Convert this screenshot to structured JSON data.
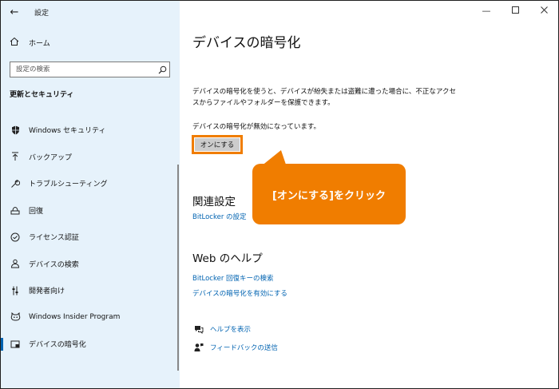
{
  "window": {
    "title": "設定"
  },
  "sidebar": {
    "home_label": "ホーム",
    "search_placeholder": "設定の検索",
    "section_title": "更新とセキュリティ",
    "items": [
      {
        "label": "Windows セキュリティ",
        "icon": "shield-icon"
      },
      {
        "label": "バックアップ",
        "icon": "backup-arrow-icon"
      },
      {
        "label": "トラブルシューティング",
        "icon": "wrench-icon"
      },
      {
        "label": "回復",
        "icon": "recovery-icon"
      },
      {
        "label": "ライセンス認証",
        "icon": "checkmark-circle-icon"
      },
      {
        "label": "デバイスの検索",
        "icon": "person-location-icon"
      },
      {
        "label": "開発者向け",
        "icon": "developer-sliders-icon"
      },
      {
        "label": "Windows Insider Program",
        "icon": "insider-cat-icon"
      },
      {
        "label": "デバイスの暗号化",
        "icon": "encryption-icon",
        "selected": true
      }
    ]
  },
  "main": {
    "title": "デバイスの暗号化",
    "description": "デバイスの暗号化を使うと、デバイスが紛失または盗難に遭った場合に、不正なアクセスからファイルやフォルダーを保護できます。",
    "status": "デバイスの暗号化が無効になっています。",
    "on_button": "オンにする",
    "related_title": "関連設定",
    "related_link": "BitLocker の設定",
    "help_title": "Web のヘルプ",
    "help_links": [
      "BitLocker 回復キーの検索",
      "デバイスの暗号化を有効にする"
    ],
    "get_help": "ヘルプを表示",
    "feedback": "フィードバックの送信"
  },
  "callout": {
    "text": "[オンにする]をクリック",
    "color": "#f07d00"
  },
  "colors": {
    "accent": "#0063b1",
    "sidebar_bg": "#e6f2fb"
  }
}
